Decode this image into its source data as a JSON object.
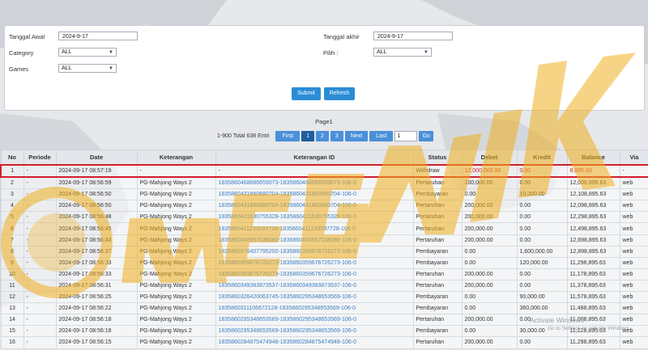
{
  "colors": {
    "accent": "#2b8cd6",
    "highlight": "#d21f2b",
    "link": "#3b7fc4",
    "watermark": "#f0b020"
  },
  "filter": {
    "tanggal_awal_label": "Tanggal Awal",
    "tanggal_awal_value": "2024-9-17",
    "tanggal_akhir_label": "Tanggal akhir",
    "tanggal_akhir_value": "2024-9-17",
    "category_label": "Category",
    "category_value": "ALL",
    "pilih_label": "Pilih :",
    "pilih_value": "ALL",
    "games_label": "Games",
    "games_value": "ALL",
    "submit_label": "Submit",
    "refresh_label": "Refresh"
  },
  "pager": {
    "title": "Page1",
    "info": "1-900 Total 638 Entri",
    "first": "First",
    "p1": "1",
    "p2": "2",
    "p3": "3",
    "next": "Next",
    "last": "Last",
    "input_value": "1",
    "go": "Go"
  },
  "table": {
    "headers": {
      "no": "No",
      "periode": "Periode",
      "date": "Date",
      "keterangan": "Keterangan",
      "ket_id": "Keterangan ID",
      "status": "Status",
      "debet": "Debet",
      "kredit": "Kredit",
      "balance": "Balance",
      "via": "Via"
    },
    "rows": [
      {
        "no": "1",
        "periode": "-",
        "date": "2024-09-17 08:57:19",
        "ket": "-",
        "id": "-",
        "status": "Withdraw",
        "debet": "12,000,000.00",
        "kredit": "0.00",
        "balance": "8,895.63",
        "via": "-"
      },
      {
        "no": "2",
        "periode": "-",
        "date": "2024-09-17 08:56:59",
        "ket": "PG-Mahjong Ways 2",
        "id": "1835860468686659073-1835860468686659073-106-0",
        "status": "Pertaruhan",
        "debet": "100,000.00",
        "kredit": "0.00",
        "balance": "12,008,895.63",
        "via": "web"
      },
      {
        "no": "3",
        "periode": "-",
        "date": "2024-09-17 08:56:50",
        "ket": "PG-Mahjong Ways 2",
        "id": "1835860431860680704-1835860431860680704-106-0",
        "status": "Pembayaran",
        "debet": "0.00",
        "kredit": "10,000.00",
        "balance": "12,108,895.63",
        "via": "web"
      },
      {
        "no": "4",
        "periode": "-",
        "date": "2024-09-17 08:56:50",
        "ket": "PG-Mahjong Ways 2",
        "id": "1835860431860680704-1835860431860680704-106-0",
        "status": "Pertaruhan",
        "debet": "200,000.00",
        "kredit": "0.00",
        "balance": "12,098,895.63",
        "via": "web"
      },
      {
        "no": "5",
        "periode": "-",
        "date": "2024-09-17 08:56:48",
        "ket": "PG-Mahjong Ways 2",
        "id": "1835860421630755328-1835860421630755328-106-0",
        "status": "Pertaruhan",
        "debet": "200,000.00",
        "kredit": "0.00",
        "balance": "12,298,895.63",
        "via": "web"
      },
      {
        "no": "6",
        "periode": "-",
        "date": "2024-09-17 08:56:45",
        "ket": "PG-Mahjong Ways 2",
        "id": "1835860411233097728-1835860411233097728-106-0",
        "status": "Pertaruhan",
        "debet": "200,000.00",
        "kredit": "0.00",
        "balance": "12,498,895.63",
        "via": "web"
      },
      {
        "no": "7",
        "periode": "-",
        "date": "2024-09-17 08:56:43",
        "ket": "PG-Mahjong Ways 2",
        "id": "1835860400957038080-1835860400957038080-106-0",
        "status": "Pertaruhan",
        "debet": "200,000.00",
        "kredit": "0.00",
        "balance": "12,698,895.63",
        "via": "web"
      },
      {
        "no": "8",
        "periode": "-",
        "date": "2024-09-17 08:56:37",
        "ket": "PG-Mahjong Ways 2",
        "id": "1835860376407795200-1835860359676726273-106-0",
        "status": "Pembayaran",
        "debet": "0.00",
        "kredit": "1,600,000.00",
        "balance": "12,898,895.63",
        "via": "web"
      },
      {
        "no": "9",
        "periode": "-",
        "date": "2024-09-17 08:56:33",
        "ket": "PG-Mahjong Ways 2",
        "id": "1835860359676726273-1835860359676726273-106-0",
        "status": "Pembayaran",
        "debet": "0.00",
        "kredit": "120,000.00",
        "balance": "11,298,895.63",
        "via": "web"
      },
      {
        "no": "10",
        "periode": "-",
        "date": "2024-09-17 08:56:33",
        "ket": "PG-Mahjong Ways 2",
        "id": "1835860359676726273-1835860359676726273-106-0",
        "status": "Pertaruhan",
        "debet": "200,000.00",
        "kredit": "0.00",
        "balance": "11,178,895.63",
        "via": "web"
      },
      {
        "no": "11",
        "periode": "-",
        "date": "2024-09-17 08:56:31",
        "ket": "PG-Mahjong Ways 2",
        "id": "1835860349383873537-1835860349383873537-106-0",
        "status": "Pertaruhan",
        "debet": "200,000.00",
        "kredit": "0.00",
        "balance": "11,378,895.63",
        "via": "web"
      },
      {
        "no": "12",
        "periode": "-",
        "date": "2024-09-17 08:56:25",
        "ket": "PG-Mahjong Ways 2",
        "id": "1835860326420063745-1835860295348653569-106-0",
        "status": "Pembayaran",
        "debet": "0.00",
        "kredit": "90,000.00",
        "balance": "11,578,895.63",
        "via": "web"
      },
      {
        "no": "13",
        "periode": "-",
        "date": "2024-09-17 08:56:22",
        "ket": "PG-Mahjong Ways 2",
        "id": "1835860311106672128-1835860295348653569-106-0",
        "status": "Pembayaran",
        "debet": "0.00",
        "kredit": "360,000.00",
        "balance": "11,488,895.63",
        "via": "web"
      },
      {
        "no": "14",
        "periode": "-",
        "date": "2024-09-17 08:56:18",
        "ket": "PG-Mahjong Ways 2",
        "id": "1835860295348653569-1835860295348653569-106-0",
        "status": "Pertaruhan",
        "debet": "200,000.00",
        "kredit": "0.00",
        "balance": "11,008,895.63",
        "via": "web"
      },
      {
        "no": "15",
        "periode": "-",
        "date": "2024-09-17 08:56:18",
        "ket": "PG-Mahjong Ways 2",
        "id": "1835860295348653569-1835860295348653569-106-0",
        "status": "Pembayaran",
        "debet": "0.00",
        "kredit": "30,000.00",
        "balance": "11,128,895.63",
        "via": "web"
      },
      {
        "no": "16",
        "periode": "-",
        "date": "2024-09-17 08:56:15",
        "ket": "PG-Mahjong Ways 2",
        "id": "1835860284875474948-1835860284875474948-106-0",
        "status": "Pertaruhan",
        "debet": "200,000.00",
        "kredit": "0.00",
        "balance": "11,298,895.63",
        "via": "web"
      }
    ]
  },
  "overlay": {
    "activate_title": "Activate Windows",
    "activate_sub": "Go to Settings to activate Windows."
  },
  "watermark_icon": "megawin-logo-watermark"
}
